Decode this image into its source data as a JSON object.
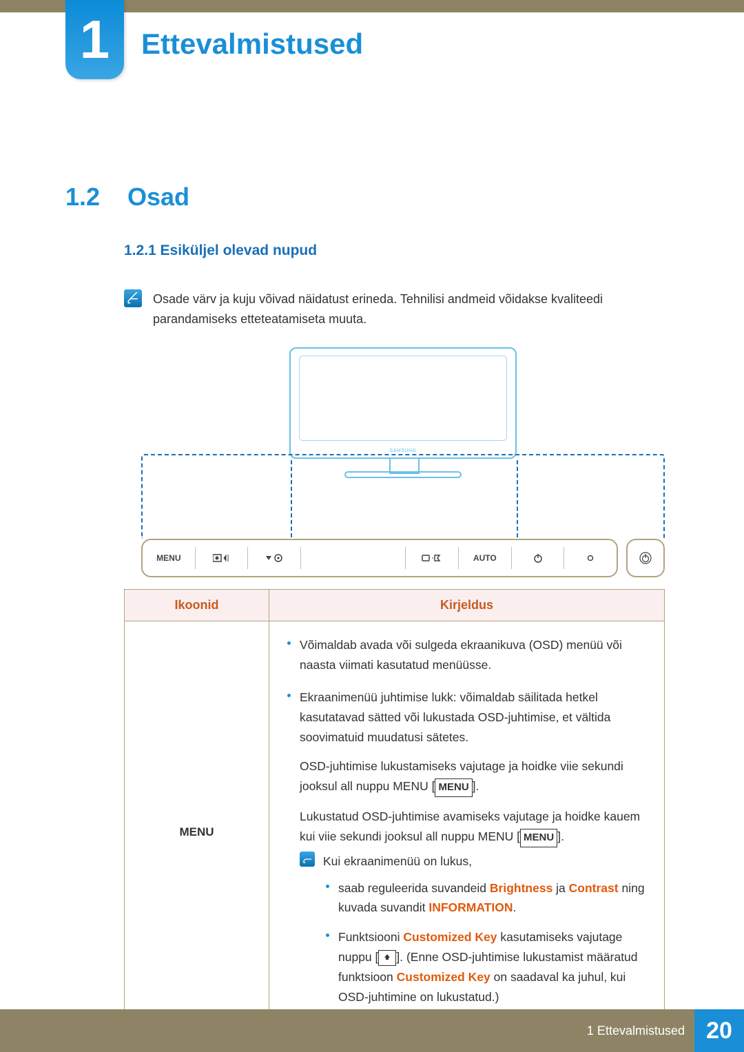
{
  "chapter": {
    "number": "1",
    "title": "Ettevalmistused"
  },
  "section": {
    "number": "1.2",
    "title": "Osad"
  },
  "subsection": {
    "label": "1.2.1  Esiküljel olevad nupud"
  },
  "note": "Osade värv ja kuju võivad näidatust erineda. Tehnilisi andmeid võidakse kvaliteedi parandamiseks etteteatamiseta muuta.",
  "monitor_brand": "SAMSUNG",
  "button_strip": {
    "items": [
      "MENU",
      "",
      "",
      "",
      "",
      "",
      "AUTO",
      "",
      ""
    ]
  },
  "table": {
    "head": {
      "col1": "Ikoonid",
      "col2": "Kirjeldus"
    },
    "row1": {
      "icon_label": "MENU",
      "bullet1": "Võimaldab avada või sulgeda ekraanikuva (OSD) menüü või naasta viimati kasutatud menüüsse.",
      "bullet2_pre": "Ekraanimenüü juhtimise lukk: võimaldab säilitada hetkel kasutatavad sätted või lukustada OSD-juhtimise, et vältida soovimatuid muudatusi sätetes.",
      "para1_a": "OSD-juhtimise lukustamiseks vajutage ja hoidke viie sekundi jooksul all nuppu MENU [",
      "para1_menu": "MENU",
      "para1_b": "].",
      "para2_a": "Lukustatud OSD-juhtimise avamiseks vajutage ja hoidke kauem kui viie sekundi jooksul all nuppu MENU [",
      "para2_menu": "MENU",
      "para2_b": "].",
      "inner_intro": "Kui ekraanimenüü on lukus,",
      "inner_b1_a": "saab reguleerida suvandeid ",
      "inner_b1_hl1": "Brightness",
      "inner_b1_mid": " ja ",
      "inner_b1_hl2": "Contrast",
      "inner_b1_b": " ning kuvada suvandit ",
      "inner_b1_hl3": "INFORMATION",
      "inner_b1_end": ".",
      "inner_b2_a": "Funktsiooni ",
      "inner_b2_hl1": "Customized Key",
      "inner_b2_b": " kasutamiseks vajutage nuppu [",
      "inner_b2_c": "]. (Enne OSD-juhtimise lukustamist määratud funktsioon ",
      "inner_b2_hl2": "Customized Key",
      "inner_b2_d": " on saadaval ka juhul, kui OSD-juhtimine on lukustatud.)"
    }
  },
  "footer": {
    "chapter_ref": "1 Ettevalmistused",
    "page": "20"
  }
}
